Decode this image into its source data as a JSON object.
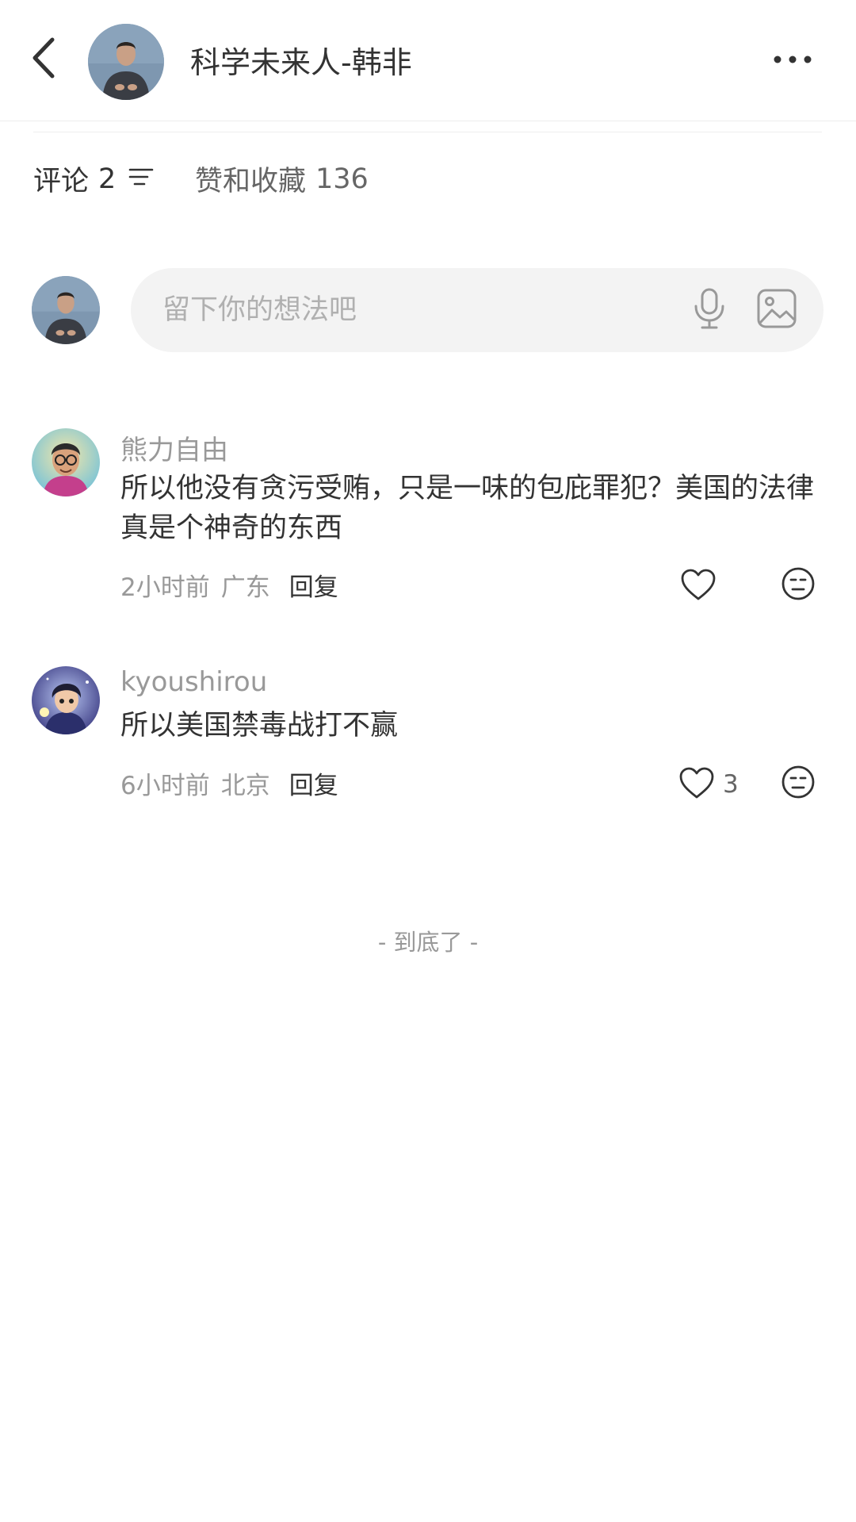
{
  "header": {
    "title": "科学未来人-韩非",
    "back_icon": "back-arrow-icon",
    "more_icon": "more-dots-icon"
  },
  "tabs": {
    "comments_label": "评论",
    "comments_count": "2",
    "likes_label": "赞和收藏",
    "likes_count": "136"
  },
  "input": {
    "placeholder": "留下你的想法吧",
    "mic_icon": "microphone-icon",
    "image_icon": "image-icon"
  },
  "comments": [
    {
      "user": "熊力自由",
      "text": "所以他没有贪污受贿，只是一味的包庇罪犯？美国的法律真是个神奇的东西",
      "time": "2小时前",
      "location": "广东",
      "reply_label": "回复",
      "likes": ""
    },
    {
      "user": "kyoushirou",
      "text": "所以美国禁毒战打不赢",
      "time": "6小时前",
      "location": "北京",
      "reply_label": "回复",
      "likes": "3"
    }
  ],
  "footer": {
    "end_text": "- 到底了 -"
  },
  "colors": {
    "primary_text": "#333333",
    "secondary_text": "#999999",
    "input_bg": "#f3f3f3"
  }
}
